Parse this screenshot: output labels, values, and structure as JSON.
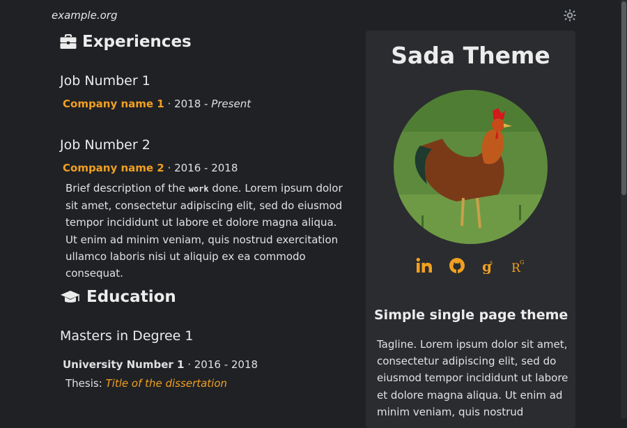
{
  "header": {
    "site": "example.org",
    "theme_toggle_icon": "sun-icon"
  },
  "experiences": {
    "heading": "Experiences",
    "icon": "briefcase-icon",
    "jobs": [
      {
        "title": "Job Number 1",
        "company": "Company name 1",
        "start": "2018",
        "end": "Present"
      },
      {
        "title": "Job Number 2",
        "company": "Company name 2",
        "start": "2016",
        "end": "2018",
        "desc_before": "Brief description of the ",
        "desc_code": "work",
        "desc_after": " done. Lorem ipsum dolor sit amet, consectetur adipiscing elit, sed do eiusmod tempor incididunt ut labore et dolore magna aliqua. Ut enim ad minim veniam, quis nostrud exercitation ullamco laboris nisi ut aliquip ex ea commodo consequat."
      }
    ]
  },
  "education": {
    "heading": "Education",
    "icon": "graduation-cap-icon",
    "items": [
      {
        "degree": "Masters in Degree 1",
        "university": "University Number 1",
        "start": "2016",
        "end": "2018",
        "thesis_label": "Thesis:",
        "thesis_title": "Title of the dissertation"
      }
    ]
  },
  "sidebar": {
    "title": "Sada Theme",
    "social": [
      "linkedin-icon",
      "github-icon",
      "google-scholar-icon",
      "researchgate-icon"
    ],
    "tagline_title": "Simple single page theme",
    "tagline": "Tagline. Lorem ipsum dolor sit amet, consectetur adipiscing elit, sed do eiusmod tempor incididunt ut labore et dolore magna aliqua. Ut enim ad minim veniam, quis nostrud"
  },
  "colors": {
    "background": "#202125",
    "panel": "#2b2c30",
    "accent": "#f0a020",
    "text": "#e6e6e6"
  }
}
